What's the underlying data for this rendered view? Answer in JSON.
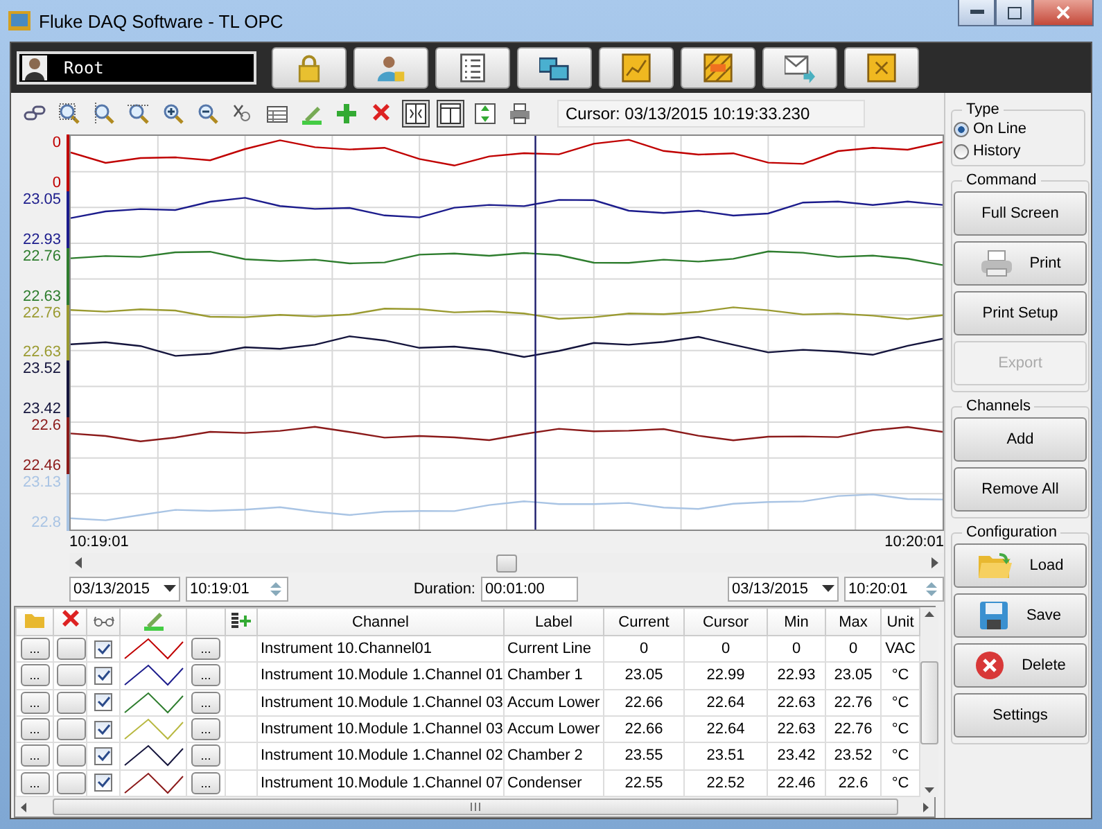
{
  "window": {
    "title": "Fluke DAQ Software - TL OPC"
  },
  "user": {
    "name": "Root"
  },
  "cursor_readout": "Cursor: 03/13/2015 10:19:33.230",
  "chart": {
    "axes": [
      {
        "max": "0",
        "min": "0",
        "color": "#c00000"
      },
      {
        "max": "23.05",
        "min": "22.93",
        "color": "#1c1c8c"
      },
      {
        "max": "22.76",
        "min": "22.63",
        "color": "#2e7d2e"
      },
      {
        "max": "22.76",
        "min": "22.63",
        "color": "#9a9a30"
      },
      {
        "max": "23.52",
        "min": "23.42",
        "color": "#14143c"
      },
      {
        "max": "22.6",
        "min": "22.46",
        "color": "#8b1a1a"
      },
      {
        "max": "23.13",
        "min": "22.8",
        "color": "#a9c4e4"
      }
    ],
    "x_start": "10:19:01",
    "x_end": "10:20:01"
  },
  "range": {
    "start_date": "03/13/2015",
    "start_time": "10:19:01",
    "duration_label": "Duration:",
    "duration": "00:01:00",
    "end_date": "03/13/2015",
    "end_time": "10:20:01"
  },
  "table": {
    "columns": [
      "Channel",
      "Label",
      "Current",
      "Cursor",
      "Min",
      "Max",
      "Unit"
    ],
    "rows": [
      {
        "channel_button": "...",
        "checked": true,
        "color": "#c00000",
        "line_button": "...",
        "channel": "Instrument 10.Channel01",
        "label": "Current Line",
        "current": "0",
        "cursor": "0",
        "min": "0",
        "max": "0",
        "unit": "VAC"
      },
      {
        "channel_button": "...",
        "checked": true,
        "color": "#1c1c8c",
        "line_button": "...",
        "channel": "Instrument 10.Module 1.Channel 01",
        "label": "Chamber 1",
        "current": "23.05",
        "cursor": "22.99",
        "min": "22.93",
        "max": "23.05",
        "unit": "°C"
      },
      {
        "channel_button": "...",
        "checked": true,
        "color": "#2e7d2e",
        "line_button": "...",
        "channel": "Instrument 10.Module 1.Channel 03",
        "label": "Accum Lower",
        "current": "22.66",
        "cursor": "22.64",
        "min": "22.63",
        "max": "22.76",
        "unit": "°C"
      },
      {
        "channel_button": "...",
        "checked": true,
        "color": "#b8b840",
        "line_button": "...",
        "channel": "Instrument 10.Module 1.Channel 03",
        "label": "Accum Lower",
        "current": "22.66",
        "cursor": "22.64",
        "min": "22.63",
        "max": "22.76",
        "unit": "°C"
      },
      {
        "channel_button": "...",
        "checked": true,
        "color": "#14143c",
        "line_button": "...",
        "channel": "Instrument 10.Module 1.Channel 02",
        "label": "Chamber 2",
        "current": "23.55",
        "cursor": "23.51",
        "min": "23.42",
        "max": "23.52",
        "unit": "°C"
      },
      {
        "channel_button": "...",
        "checked": true,
        "color": "#8b1a1a",
        "line_button": "...",
        "channel": "Instrument 10.Module 1.Channel 07",
        "label": "Condenser",
        "current": "22.55",
        "cursor": "22.52",
        "min": "22.46",
        "max": "22.6",
        "unit": "°C"
      }
    ]
  },
  "panel": {
    "type": {
      "title": "Type",
      "options": [
        {
          "label": "On Line",
          "selected": true
        },
        {
          "label": "History",
          "selected": false
        }
      ]
    },
    "groups": [
      {
        "title": "Command",
        "buttons": [
          {
            "label": "Full Screen",
            "kind": "plain",
            "disabled": false
          },
          {
            "label": "Print",
            "kind": "print",
            "disabled": false
          },
          {
            "label": "Print Setup",
            "kind": "plain",
            "disabled": false
          },
          {
            "label": "Export",
            "kind": "plain",
            "disabled": true
          }
        ]
      },
      {
        "title": "Channels",
        "buttons": [
          {
            "label": "Add",
            "kind": "plain",
            "disabled": false
          },
          {
            "label": "Remove All",
            "kind": "plain",
            "disabled": false
          }
        ]
      },
      {
        "title": "Configuration",
        "buttons": [
          {
            "label": "Load",
            "kind": "load",
            "disabled": false
          },
          {
            "label": "Save",
            "kind": "save",
            "disabled": false
          },
          {
            "label": "Delete",
            "kind": "delete",
            "disabled": false
          },
          {
            "label": "Settings",
            "kind": "plain",
            "disabled": false
          }
        ]
      }
    ]
  }
}
